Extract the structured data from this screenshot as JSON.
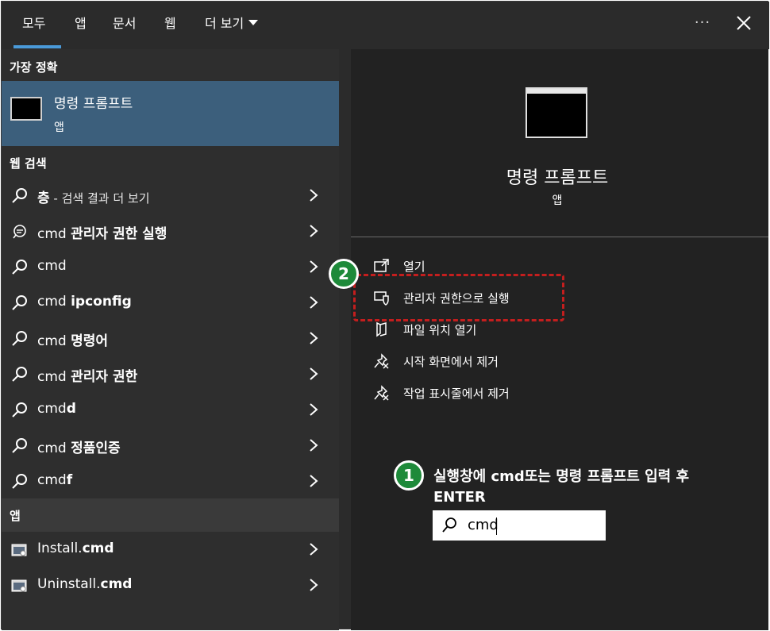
{
  "tabs": [
    {
      "label": "모두"
    },
    {
      "label": "앱"
    },
    {
      "label": "문서"
    },
    {
      "label": "웹"
    },
    {
      "label": "더 보기"
    }
  ],
  "more_label": "···",
  "left": {
    "best_match_title": "가장 정확",
    "best_match": {
      "name": "명령 프롬프트",
      "type": "앱"
    },
    "web_title": "웹 검색",
    "web_items": [
      {
        "main": "층",
        "sub": " - 검색 결과 더 보기",
        "icon": "search-icon"
      },
      {
        "pre": "cmd ",
        "bold": "관리자 권한 실행",
        "icon": "chat-search-icon"
      },
      {
        "pre": "cmd",
        "bold": "",
        "icon": "search-icon"
      },
      {
        "pre": "cmd ",
        "bold": "ipconfig",
        "icon": "search-icon"
      },
      {
        "pre": "cmd ",
        "bold": "명령어",
        "icon": "search-icon"
      },
      {
        "pre": "cmd ",
        "bold": "관리자 권한",
        "icon": "search-icon"
      },
      {
        "pre": "cmd",
        "bold": "d",
        "icon": "search-icon"
      },
      {
        "pre": "cmd ",
        "bold": "정품인증",
        "icon": "search-icon"
      },
      {
        "pre": "cmd",
        "bold": "f",
        "icon": "search-icon"
      }
    ],
    "apps_title": "앱",
    "app_items": [
      {
        "pre": "Install.",
        "bold": "cmd",
        "icon": "cmd-file-icon"
      },
      {
        "pre": "Uninstall.",
        "bold": "cmd",
        "icon": "cmd-file-icon"
      }
    ]
  },
  "right": {
    "title": "명령 프롬프트",
    "subtitle": "앱",
    "actions": [
      {
        "label": "열기",
        "icon": "open-icon"
      },
      {
        "label": "관리자 권한으로 실행",
        "icon": "shield-icon"
      },
      {
        "label": "파일 위치 열기",
        "icon": "folder-icon"
      },
      {
        "label": "시작 화면에서 제거",
        "icon": "unpin-icon"
      },
      {
        "label": "작업 표시줄에서 제거",
        "icon": "unpin-icon"
      }
    ]
  },
  "annotations": {
    "step1_number": "1",
    "step2_number": "2",
    "step1_text_line1": "실행창에 cmd또는 명령 프롬프트 입력 후",
    "step1_text_line2": "ENTER",
    "search_value": "cmd"
  },
  "colors": {
    "selected_row": "#3c5f7c",
    "tab_underline": "#4a9ad9",
    "badge_green": "#1e8a3a",
    "highlight_red": "#c41e1e"
  }
}
